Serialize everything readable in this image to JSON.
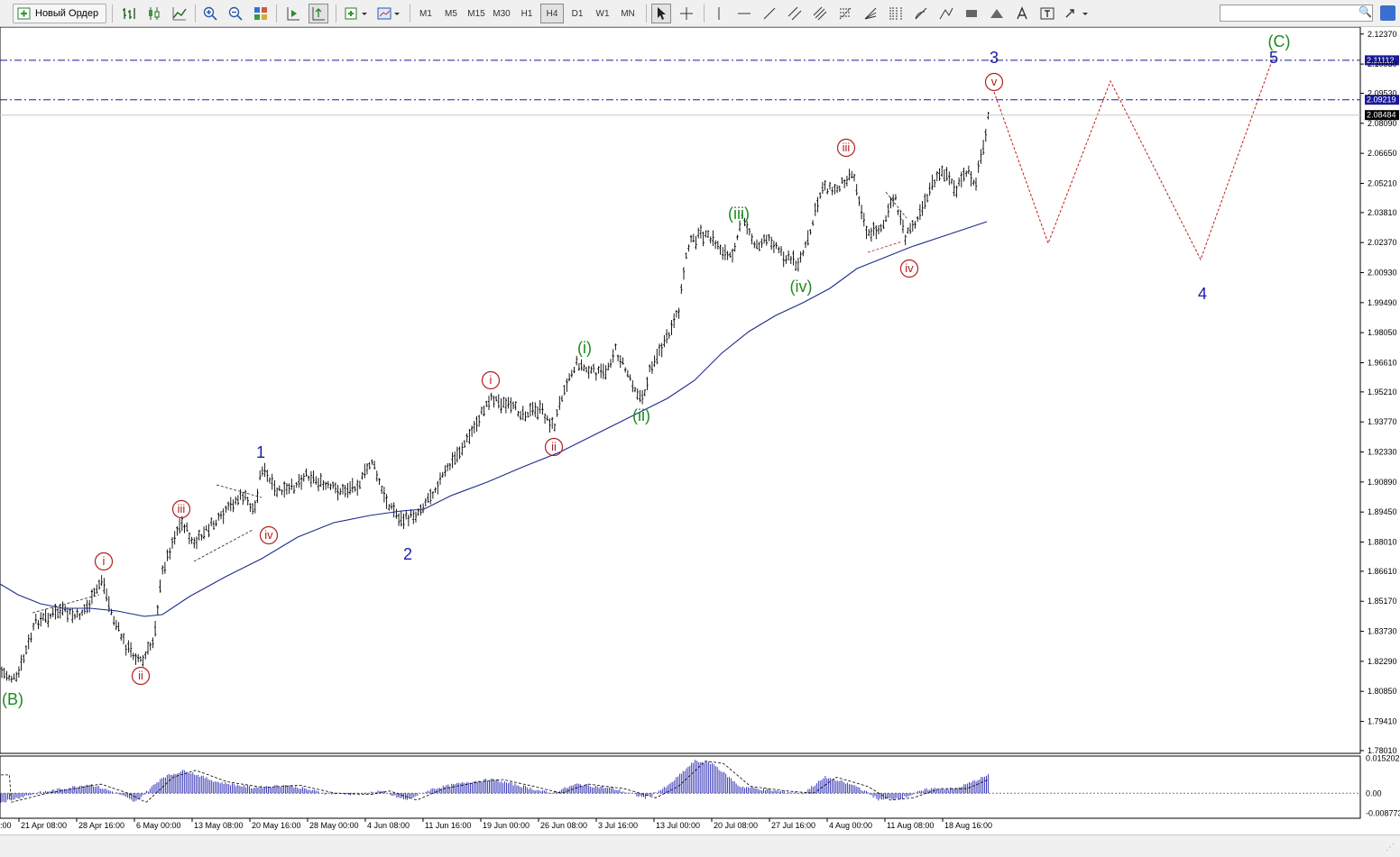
{
  "toolbar": {
    "new_order_label": "Новый Ордер",
    "timeframes": [
      "M1",
      "M5",
      "M15",
      "M30",
      "H1",
      "H4",
      "D1",
      "W1",
      "MN"
    ],
    "active_timeframe": "H4"
  },
  "chart_data": {
    "type": "ohlc",
    "series": [
      {
        "name": "price"
      },
      {
        "name": "moving-average",
        "style": "line",
        "color": "#1c2a8c"
      }
    ],
    "y_ticks": [
      "2.12370",
      "2.10930",
      "2.09530",
      "2.08090",
      "2.06650",
      "2.05210",
      "2.03810",
      "2.02370",
      "2.00930",
      "1.99490",
      "1.98050",
      "1.96610",
      "1.95210",
      "1.93770",
      "1.92330",
      "1.90890",
      "1.89450",
      "1.88010",
      "1.86610",
      "1.85170",
      "1.83730",
      "1.82290",
      "1.80850",
      "1.79410",
      "1.78010"
    ],
    "ylim": [
      1.7792,
      2.1262
    ],
    "x_ticks": [
      "21 Apr 08:00",
      "28 Apr 16:00",
      "6 May 00:00",
      "13 May 08:00",
      "20 May 16:00",
      "28 May 00:00",
      "4 Jun 08:00",
      "11 Jun 16:00",
      "19 Jun 00:00",
      "26 Jun 08:00",
      "3 Jul 16:00",
      "13 Jul 00:00",
      "20 Jul 08:00",
      "27 Jul 16:00",
      "4 Aug 00:00",
      "11 Aug 08:00",
      "18 Aug 16:00"
    ],
    "x_tick_partial": ":00",
    "price_lines": [
      {
        "label": "2.11112",
        "value": 2.11112,
        "style": "dashdot",
        "color": "#1a1a9c"
      },
      {
        "label": "2.09219",
        "value": 2.09219,
        "style": "dashdot",
        "color": "#1a1a9c"
      }
    ],
    "current_price": "2.08484",
    "current_price_value": 2.08484,
    "oscillator": {
      "y_ticks": [
        "0.015202",
        "0.00",
        "-0.008773"
      ],
      "ylim": [
        -0.0105,
        0.0158
      ]
    },
    "wave_labels": {
      "B_major": "(B)",
      "C_major": "(C)",
      "w1": "1",
      "w2": "2",
      "w3": "3",
      "w4": "4",
      "w5": "5",
      "g_i": "(i)",
      "g_ii": "(ii)",
      "g_iii": "(iii)",
      "g_iv": "(iv)",
      "r_i_a": "i",
      "r_ii_a": "ii",
      "r_iii_a": "iii",
      "r_iv_a": "iv",
      "r_i_b": "i",
      "r_ii_b": "ii",
      "r_iii_b": "iii",
      "r_iv_b": "iv",
      "r_v_b": "v"
    },
    "colors": {
      "wave_blue": "#1a1aa8",
      "wave_green": "#1e8a1e",
      "wave_red": "#b02020",
      "price_bar": "#000000",
      "ma_line": "#1c2a8c",
      "oscillator_bars": "#2a2ab0",
      "projection": "#c02020"
    }
  }
}
